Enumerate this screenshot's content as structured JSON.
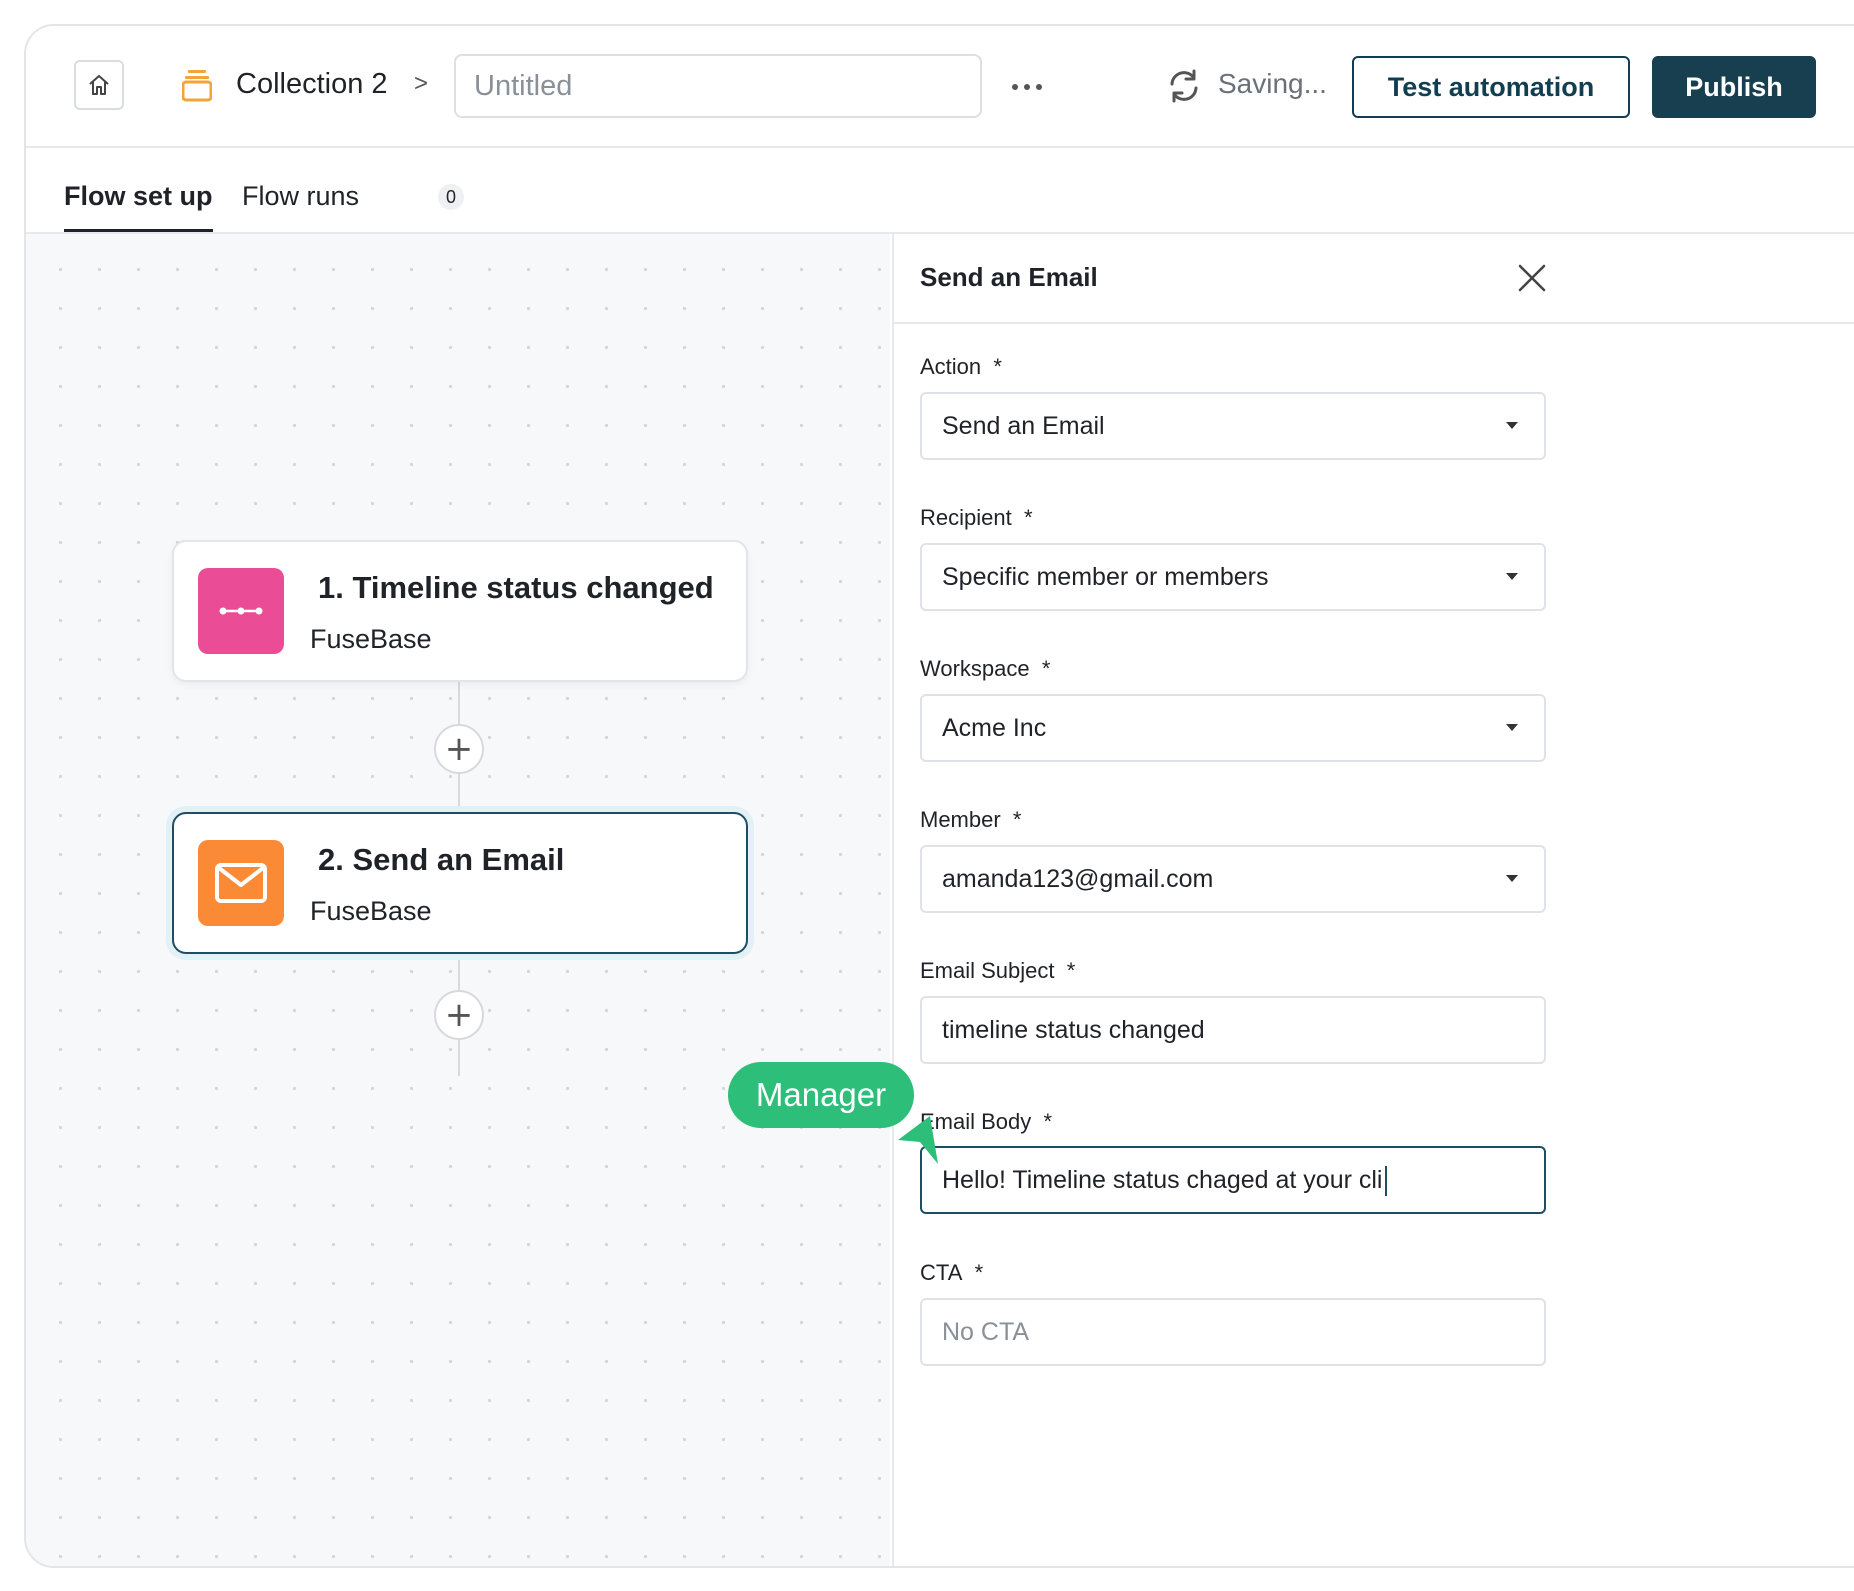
{
  "header": {
    "breadcrumb_label": "Collection 2",
    "breadcrumb_separator": ">",
    "name_placeholder": "Untitled",
    "saving_text": "Saving...",
    "test_button_label": "Test automation",
    "publish_button_label": "Publish"
  },
  "tabs": [
    {
      "label": "Flow set up",
      "active": true
    },
    {
      "label": "Flow runs",
      "badge": "0",
      "active": false
    }
  ],
  "flow": {
    "nodes": [
      {
        "number": "1.",
        "title": "Timeline status changed",
        "subtitle": "FuseBase",
        "icon": "timeline-icon",
        "icon_color": "#ea4c96"
      },
      {
        "number": "2.",
        "title": "Send an Email",
        "subtitle": "FuseBase",
        "icon": "mail-icon",
        "icon_color": "#fb8a37",
        "selected": true
      }
    ],
    "add_symbol": "+"
  },
  "panel": {
    "title": "Send an Email",
    "fields": [
      {
        "label": "Action",
        "required": "*",
        "value": "Send an Email",
        "type": "select"
      },
      {
        "label": "Recipient",
        "required": "*",
        "value": "Specific member or members",
        "type": "select"
      },
      {
        "label": "Workspace",
        "required": "*",
        "value": "Acme Inc",
        "type": "select"
      },
      {
        "label": "Member",
        "required": "*",
        "value": "amanda123@gmail.com",
        "type": "select"
      },
      {
        "label": "Email Subject",
        "required": "*",
        "value": "timeline status changed",
        "type": "text"
      },
      {
        "label": "Email Body",
        "required": "*",
        "value": "Hello! Timeline status chaged at your cli",
        "type": "text",
        "focused": true
      },
      {
        "label": "CTA",
        "required": "*",
        "placeholder": "No CTA",
        "type": "text"
      }
    ]
  },
  "cursor": {
    "label": "Manager",
    "color": "#2dbe7a"
  },
  "colors": {
    "primary": "#173f50",
    "accent_pink": "#ea4c96",
    "accent_orange": "#fb8a37",
    "cursor_green": "#2dbe7a"
  }
}
